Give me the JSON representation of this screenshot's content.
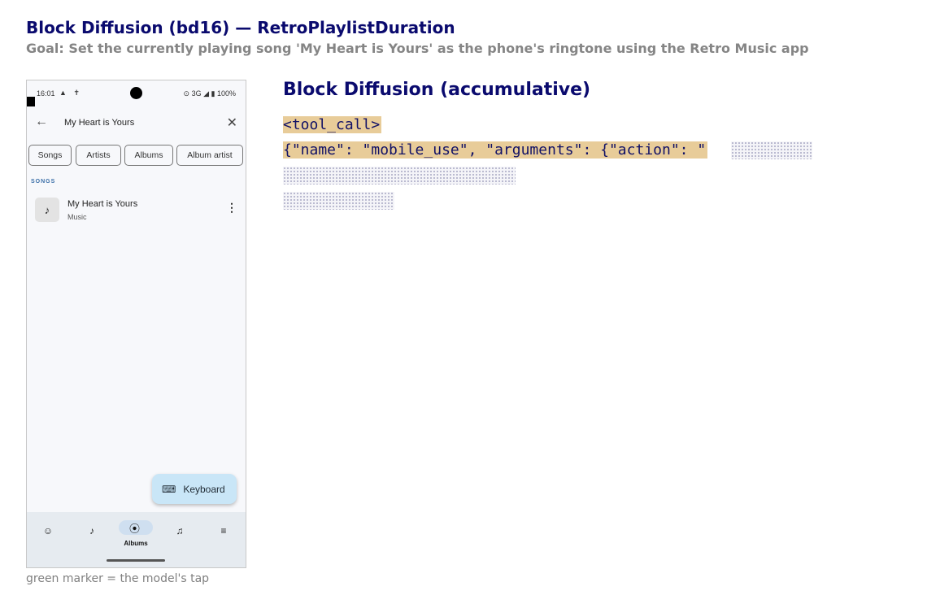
{
  "header": {
    "title": "Block Diffusion (bd16) — RetroPlaylistDuration",
    "goal": "Goal: Set the currently playing song 'My Heart is Yours' as the phone's ringtone using the Retro Music app"
  },
  "phone": {
    "status": {
      "time": "16:01",
      "left_icons": "▲ ✝",
      "right": "⊙ 3G ◢ ▮ 100%"
    },
    "search": {
      "query": "My Heart is Yours",
      "back_icon": "←",
      "close_icon": "✕"
    },
    "chips": [
      "Songs",
      "Artists",
      "Albums",
      "Album artist"
    ],
    "section_label": "SONGS",
    "song": {
      "title": "My Heart is Yours",
      "subtitle": "Music",
      "thumb_icon": "♪",
      "menu_icon": "⋮"
    },
    "keyboard_button": {
      "label": "Keyboard",
      "icon": "⌨"
    },
    "bottom_nav": {
      "items": [
        {
          "name": "for-you",
          "icon": "☺"
        },
        {
          "name": "songs",
          "icon": "♪"
        },
        {
          "name": "albums",
          "icon": "⦿",
          "label": "Albums",
          "selected": true
        },
        {
          "name": "artists",
          "icon": "♫"
        },
        {
          "name": "playlists",
          "icon": "≡"
        }
      ]
    }
  },
  "caption": "green marker = the model's tap",
  "panel": {
    "heading": "Block Diffusion (accumulative)",
    "lines": [
      "<tool_call>",
      "{\"name\": \"mobile_use\", \"arguments\": {\"action\": \""
    ]
  },
  "colors": {
    "heading": "#0a0a6e",
    "highlight": "#e8cc99",
    "masked": "#a6a6c2",
    "nav_bg": "#e6ebf0",
    "kbd_bg": "#c9e6f7"
  }
}
